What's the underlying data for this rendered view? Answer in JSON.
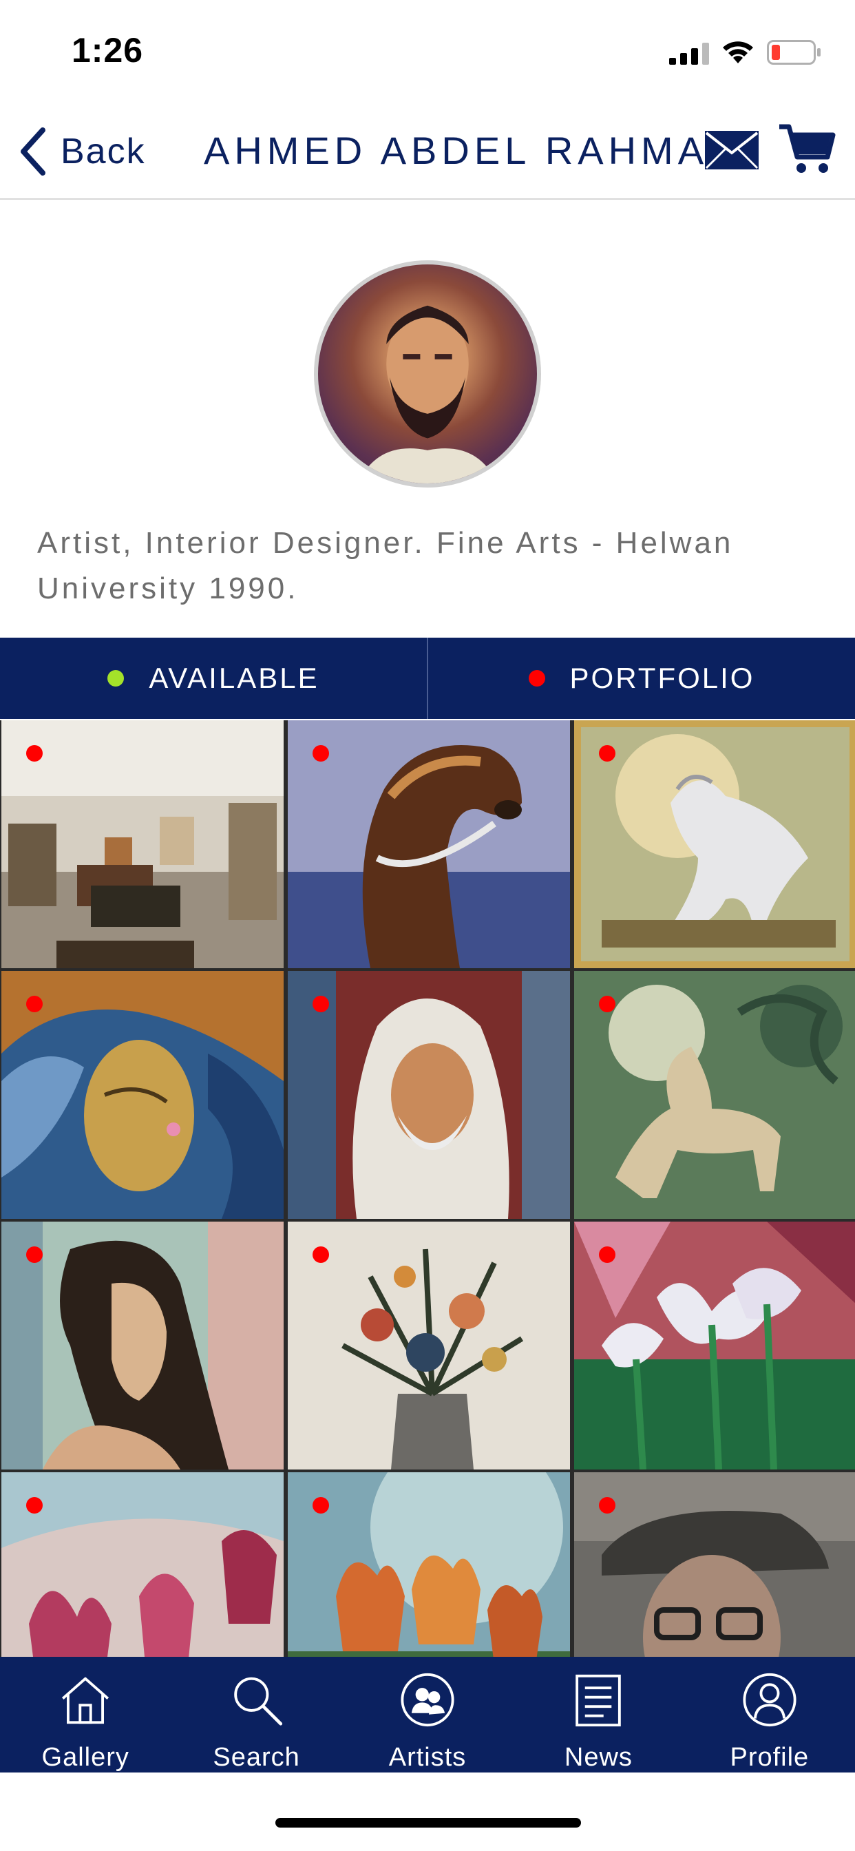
{
  "status_bar": {
    "time": "1:26",
    "signal_icon": "cellular-signal-icon",
    "wifi_icon": "wifi-icon",
    "battery_icon": "battery-low-icon",
    "battery_color": "#ff3b30"
  },
  "nav": {
    "back_label": "Back",
    "title": "AHMED ABDEL RAHMAN",
    "mail_icon": "envelope-icon",
    "cart_icon": "cart-icon"
  },
  "profile": {
    "avatar_icon": "artist-portrait",
    "bio": "Artist, Interior Designer. Fine Arts - Helwan University 1990."
  },
  "filters": [
    {
      "label": "AVAILABLE",
      "dot_color": "#a4e22a"
    },
    {
      "label": "PORTFOLIO",
      "dot_color": "#ff0000"
    }
  ],
  "artworks": [
    {
      "subject": "gallery interior",
      "status_color": "#ff0000"
    },
    {
      "subject": "arabian horse head",
      "status_color": "#ff0000"
    },
    {
      "subject": "white horse",
      "status_color": "#ff0000"
    },
    {
      "subject": "woman with flowing hair",
      "status_color": "#ff0000"
    },
    {
      "subject": "old man with headscarf",
      "status_color": "#ff0000"
    },
    {
      "subject": "horse with calligraphy",
      "status_color": "#ff0000"
    },
    {
      "subject": "woman profile",
      "status_color": "#ff0000"
    },
    {
      "subject": "flowers in vase",
      "status_color": "#ff0000"
    },
    {
      "subject": "white iris flowers",
      "status_color": "#ff0000"
    },
    {
      "subject": "pink tulips",
      "status_color": "#ff0000"
    },
    {
      "subject": "orange tulips",
      "status_color": "#ff0000"
    },
    {
      "subject": "man with hat and glasses",
      "status_color": "#ff0000"
    }
  ],
  "tab_bar": [
    {
      "label": "Gallery",
      "icon": "home-icon"
    },
    {
      "label": "Search",
      "icon": "search-icon"
    },
    {
      "label": "Artists",
      "icon": "artists-icon"
    },
    {
      "label": "News",
      "icon": "news-icon"
    },
    {
      "label": "Profile",
      "icon": "profile-icon"
    }
  ],
  "colors": {
    "brand_navy": "#0b2160",
    "bio_text": "#6d6d6d"
  }
}
